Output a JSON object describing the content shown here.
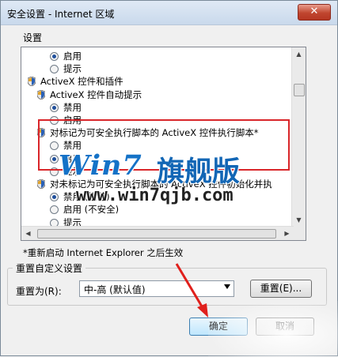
{
  "window": {
    "title": "安全设置 - Internet 区域",
    "close_label": "✕"
  },
  "settings": {
    "label": "设置",
    "rows": [
      {
        "kind": "radio",
        "checked": true,
        "text": "启用",
        "indent": 2
      },
      {
        "kind": "radio",
        "checked": false,
        "text": "提示",
        "indent": 2
      },
      {
        "kind": "shield",
        "text": "ActiveX 控件和插件",
        "indent": 0
      },
      {
        "kind": "shield",
        "text": "ActiveX 控件自动提示",
        "indent": 1
      },
      {
        "kind": "radio",
        "checked": true,
        "text": "禁用",
        "indent": 2
      },
      {
        "kind": "radio",
        "checked": false,
        "text": "启用",
        "indent": 2
      },
      {
        "kind": "shield",
        "text": "对标记为可安全执行脚本的 ActiveX 控件执行脚本*",
        "indent": 1
      },
      {
        "kind": "radio",
        "checked": false,
        "text": "禁用",
        "indent": 2
      },
      {
        "kind": "radio",
        "checked": true,
        "text": "启用",
        "indent": 2
      },
      {
        "kind": "radio",
        "checked": false,
        "text": "提示",
        "indent": 2
      },
      {
        "kind": "shield",
        "text": "对未标记为可安全执行脚本的 ActiveX 控件初始化并执",
        "indent": 1
      },
      {
        "kind": "radio",
        "checked": true,
        "text": "禁用 (推荐)",
        "indent": 2
      },
      {
        "kind": "radio",
        "checked": false,
        "text": "启用 (不安全)",
        "indent": 2
      },
      {
        "kind": "radio",
        "checked": false,
        "text": "提示",
        "indent": 2
      },
      {
        "kind": "shield",
        "text": "二进制和脚本行为",
        "indent": 1
      }
    ]
  },
  "note": "*重新启动 Internet Explorer 之后生效",
  "reset_group": {
    "title": "重置自定义设置",
    "reset_to_label": "重置为(R):",
    "select_value": "中-高 (默认值)",
    "reset_button": "重置(E)..."
  },
  "buttons": {
    "ok": "确定",
    "cancel": "取消"
  },
  "watermark": {
    "logo": "Win7",
    "cn": "旗舰版",
    "url": "www.win7qjb.com"
  },
  "colors": {
    "highlight_border": "#d9262a",
    "watermark_blue": "#1572c7",
    "arrow_red": "#e0201c"
  }
}
